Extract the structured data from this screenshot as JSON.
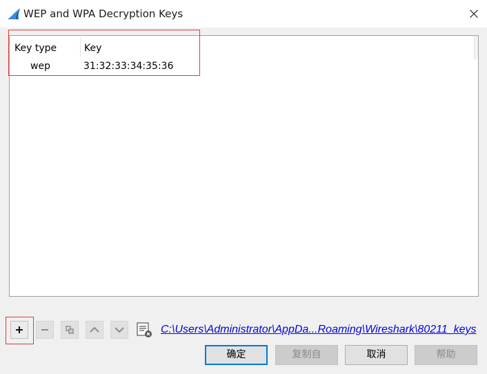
{
  "window": {
    "title": "WEP and WPA Decryption Keys",
    "close_glyph": "✕"
  },
  "table": {
    "columns": [
      "Key type",
      "Key"
    ],
    "rows": [
      {
        "key_type": "wep",
        "key": "31:32:33:34:35:36"
      }
    ]
  },
  "toolbar": {
    "add": "+",
    "remove": "−",
    "copy": "copy-icon",
    "move_up": "chevron-up-icon",
    "move_down": "chevron-down-icon",
    "clear": "clear-list-icon"
  },
  "file_path": "C:\\Users\\Administrator\\AppDa...Roaming\\Wireshark\\80211_keys",
  "buttons": {
    "ok": "确定",
    "copy_from": "复制自",
    "cancel": "取消",
    "help": "帮助"
  },
  "colors": {
    "highlight": "#e03a3a",
    "link": "#0000e0",
    "default_button_border": "#0078d7",
    "app_icon": "#1f5fa8"
  }
}
